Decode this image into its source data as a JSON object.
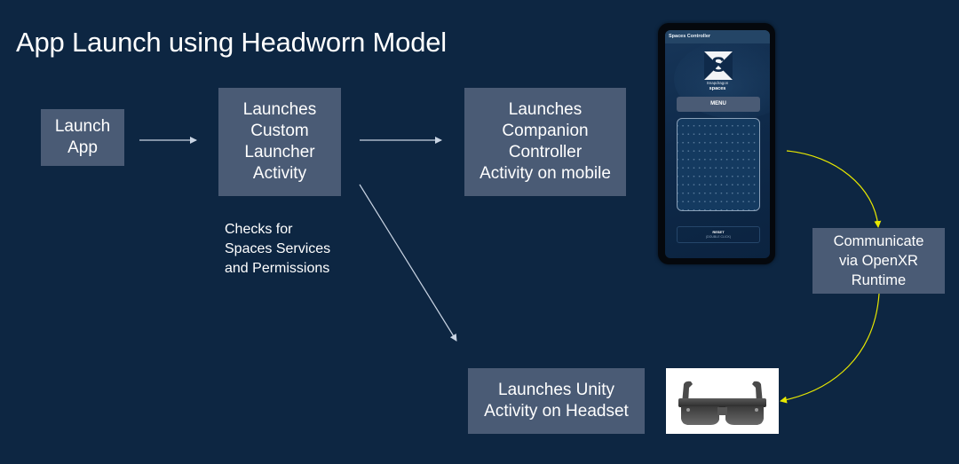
{
  "title": "App Launch using Headworn Model",
  "nodes": {
    "launch_app": "Launch\nApp",
    "custom_launcher": "Launches\nCustom\nLauncher\nActivity",
    "companion_controller": "Launches\nCompanion\nController\nActivity on mobile",
    "openxr": "Communicate\nvia OpenXR\nRuntime",
    "unity_headset": "Launches Unity\nActivity on Headset"
  },
  "note": "Checks for\nSpaces Services\nand Permissions",
  "phone": {
    "app_bar_title": "Spaces Controller",
    "brand_top": "Snapdragon",
    "brand_bottom": "spaces",
    "logo_letter": "S",
    "menu_label": "MENU",
    "reset_label": "RESET",
    "reset_sublabel": "(DOUBLE CLICK)"
  },
  "images": {
    "glasses": "AR glasses headset"
  },
  "colors": {
    "background": "#0d2642",
    "box": "#4a5b75",
    "arrow": "#c9d4e3",
    "accent_arrow": "#e8e800"
  }
}
